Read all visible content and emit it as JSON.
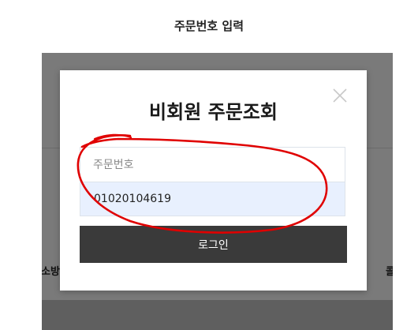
{
  "page": {
    "heading": "주문번호 입력"
  },
  "background": {
    "left_text": "소방",
    "right_text": "콜"
  },
  "modal": {
    "title": "비회원 주문조회",
    "order_number_placeholder": "주문번호",
    "phone_value": "01020104619",
    "login_label": "로그인",
    "close_icon": "close-icon"
  },
  "colors": {
    "overlay": "#7a7a7a",
    "input_autofill": "#e8f0fe",
    "button": "#3a3a3a",
    "annotation": "#e00000"
  }
}
